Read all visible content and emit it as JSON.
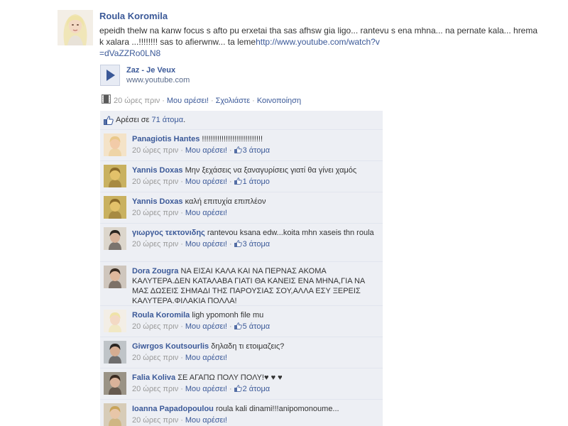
{
  "post": {
    "author": "Roula Koromila",
    "text": "epeidh thelw na kanw focus s afto pu erxetai tha sas afhsw gia ligo... rantevu s ena mhna... na pernate kala... hrema k xalara ...!!!!!!!! sas to afierwnw... ta leme",
    "url_part1": "http://www.youtube.com/watch?v",
    "url_part2": "=dVaZZRo0LN8",
    "attachment": {
      "title": "Zaz - Je Veux",
      "domain": "www.youtube.com"
    },
    "meta": {
      "time": "20 ώρες πριν",
      "like": "Μου αρέσει!",
      "comment": "Σχολιάστε",
      "share": "Κοινοποίηση",
      "separator": "·"
    }
  },
  "likes": {
    "prefix": "Αρέσει σε ",
    "count_link": "71 άτομα",
    "suffix": "."
  },
  "comments": [
    {
      "author": "Panagiotis Hantes",
      "text": "!!!!!!!!!!!!!!!!!!!!!!!!!!!!",
      "time": "20 ώρες πριν",
      "like": "Μου αρέσει!",
      "likes": "3 άτομα"
    },
    {
      "author": "Yannis Doxas",
      "text": "Μην ξεχάσεις να ξαναγυρίσεις γιατί θα γίνει χαμός",
      "time": "20 ώρες πριν",
      "like": "Μου αρέσει!",
      "likes": "1 άτομο"
    },
    {
      "author": "Yannis Doxas",
      "text": "καλή επιτυχία επιπλέον",
      "time": "20 ώρες πριν",
      "like": "Μου αρέσει!",
      "likes": ""
    },
    {
      "author": "γιωργος τεκτονιδης",
      "text": "rantevou ksana edw...koita mhn xaseis thn roula",
      "time": "20 ώρες πριν",
      "like": "Μου αρέσει!",
      "likes": "3 άτομα"
    },
    {
      "author": "Dora Zougra",
      "text": "ΝΑ ΕΙΣΑΙ ΚΑΛΑ ΚΑΙ ΝΑ ΠΕΡΝΑΣ ΑΚΟΜΑ ΚΑΛΥΤΕΡΑ.ΔΕΝ ΚΑΤΑΛΑΒΑ ΓΙΑΤΙ ΘΑ ΚΑΝΕΙΣ ΕΝΑ ΜΗΝΑ,ΓΙΑ ΝΑ ΜΑΣ ΔΩΣΕΙΣ ΣΗΜΑΔΙ ΤΗΣ ΠΑΡΟΥΣΙΑΣ ΣΟΥ,ΑΛΛΑ ΕΣΥ ΞΕΡΕΙΣ ΚΑΛΥΤΕΡΑ.ΦΙΛΑΚΙΑ ΠΟΛΛΑ!",
      "time": "20 ώρες πριν",
      "like": "Μου αρέσει!",
      "likes": ""
    },
    {
      "author": "Roula Koromila",
      "text": "ligh ypomonh file mu",
      "time": "20 ώρες πριν",
      "like": "Μου αρέσει!",
      "likes": "5 άτομα"
    },
    {
      "author": "Giwrgos Koutsourlis",
      "text": "δηλαδη τι ετοιμαζεις?",
      "time": "20 ώρες πριν",
      "like": "Μου αρέσει!",
      "likes": ""
    },
    {
      "author": "Falia Koliva",
      "text": "ΣΕ ΑΓΑΠΩ ΠΟΛΥ ΠΟΛΥ!♥ ♥ ♥",
      "time": "20 ώρες πριν",
      "like": "Μου αρέσει!",
      "likes": "2 άτομα"
    },
    {
      "author": "Ioanna Papadopoulou",
      "text": "roula kali dinami!!!anipomonoume...",
      "time": "20 ώρες πριν",
      "like": "Μου αρέσει!",
      "likes": ""
    }
  ],
  "colors": {
    "link": "#3b5998",
    "feedback_bg": "#edeff4",
    "muted": "#999999"
  }
}
